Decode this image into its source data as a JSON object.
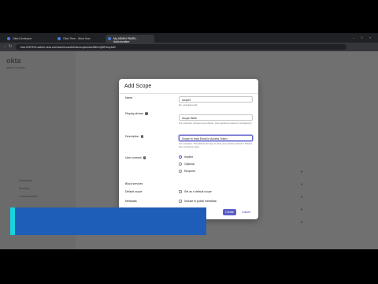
{
  "browser": {
    "tabs": [
      {
        "label": "Okta Developer"
      },
      {
        "label": "Okta Time - Work flow"
      },
      {
        "label": "My ADMIN PANEL - Authorization"
      }
    ],
    "url": "trial-3267876-admin.okta.com/admin/oauth2/as/scopes/aus5Nhv4jfDRxcq4s6/"
  },
  "sidebar": {
    "logo": "okta",
    "org": "Admin Console",
    "items": [
      "Dashboard",
      "Directory",
      "Customizations"
    ]
  },
  "dialog": {
    "title": "Add Scope",
    "fields": [
      {
        "label": "Name",
        "value": "scope2",
        "help": "Ex: example:read"
      },
      {
        "label": "Display phrase",
        "value": "Scope Write",
        "help": "For example: Access your photos. Use sentence-case for consistency."
      },
      {
        "label": "Description",
        "value": "Scope to read Email in Access Token",
        "help": "For example: This allows the app to view your photos stored in Photos. Use sentence-case."
      }
    ],
    "consent": {
      "label": "User consent",
      "options": [
        "Implicit",
        "Optional",
        "Required"
      ],
      "selected": "Implicit"
    },
    "block_services_label": "Block services",
    "default_scope": {
      "label": "Default scope",
      "option": "Set as a default scope"
    },
    "metadata": {
      "label": "Metadata",
      "option": "Include in public metadata"
    },
    "buttons": {
      "create": "Create",
      "cancel": "Cancel"
    }
  },
  "colors": {
    "primary": "#5b5fc7",
    "banner": "#1f5eb8",
    "banner_accent": "#18d3e0"
  }
}
